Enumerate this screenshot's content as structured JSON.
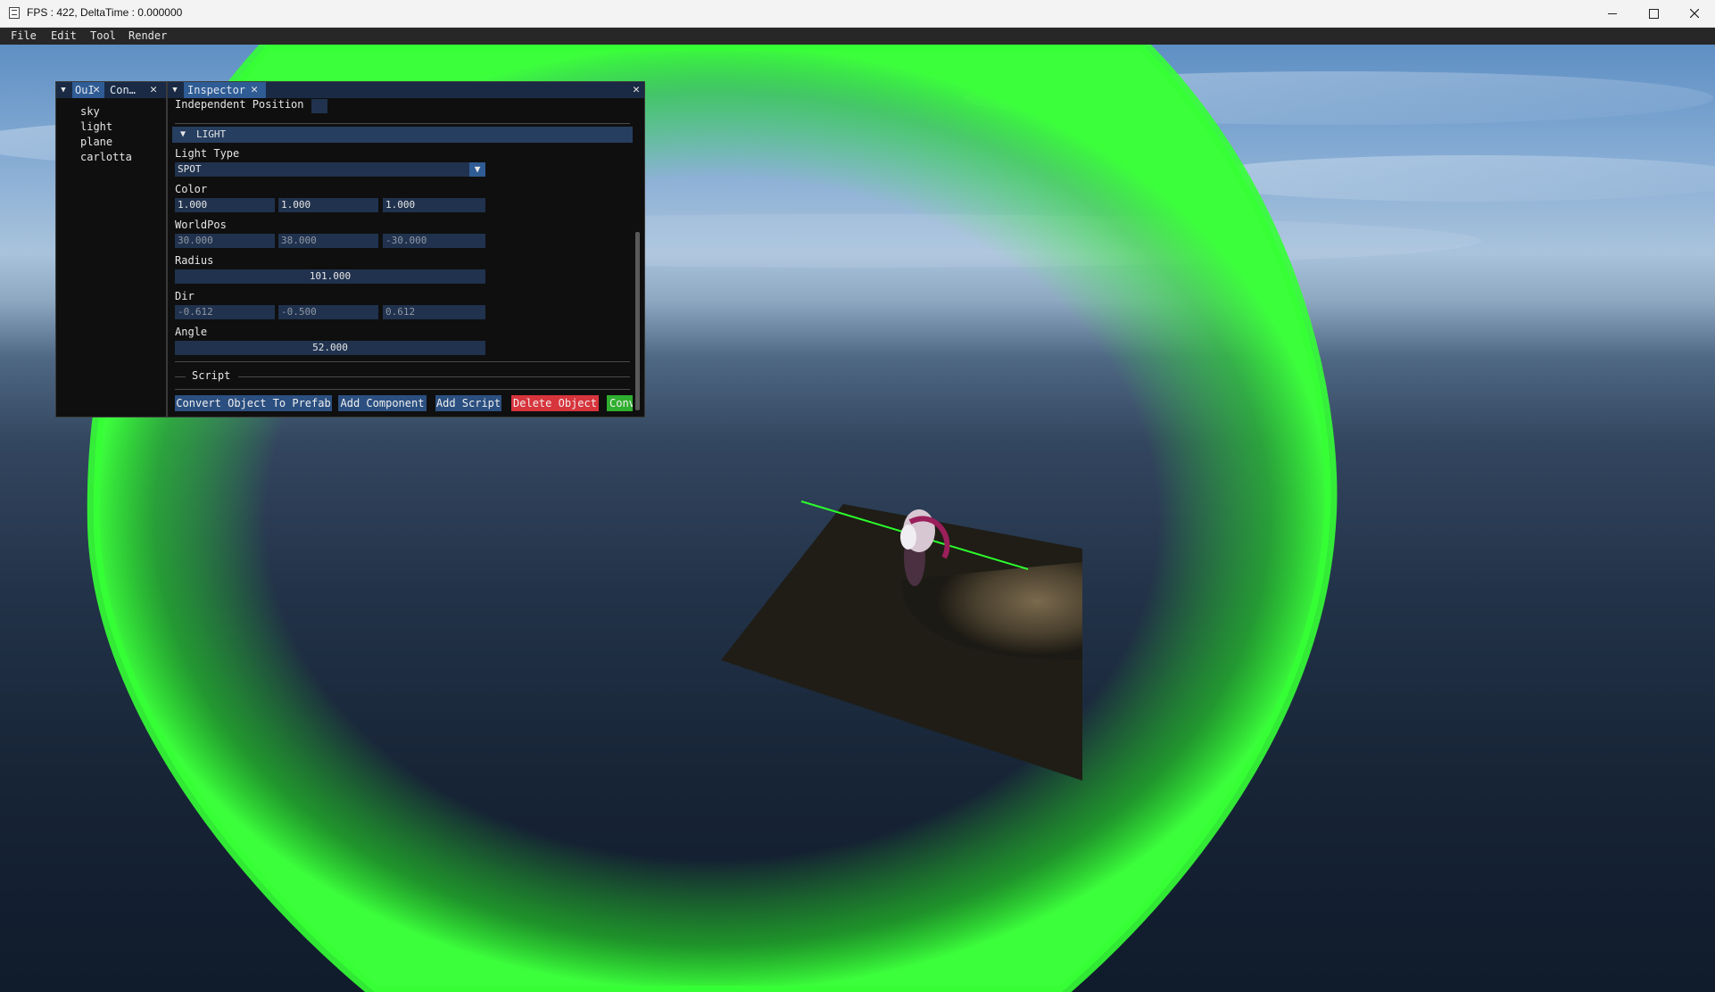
{
  "window": {
    "title": "FPS : 422, DeltaTime : 0.000000",
    "controls": [
      "minimize",
      "maximize",
      "close"
    ]
  },
  "menu": [
    "File",
    "Edit",
    "Tool",
    "Render"
  ],
  "outliner": {
    "tabs": [
      "OuI",
      "Con…"
    ],
    "items": [
      "sky",
      "light",
      "plane",
      "carlotta"
    ]
  },
  "inspector": {
    "tab": "Inspector",
    "independent_position_label": "Independent Position",
    "section_header": "LIGHT",
    "light_type_label": "Light Type",
    "light_type_value": "SPOT",
    "color_label": "Color",
    "color_values": [
      "1.000",
      "1.000",
      "1.000"
    ],
    "worldpos_label": "WorldPos",
    "worldpos_values": [
      "30.000",
      "38.000",
      "-30.000"
    ],
    "radius_label": "Radius",
    "radius_value": "101.000",
    "dir_label": "Dir",
    "dir_values": [
      "-0.612",
      "-0.500",
      "0.612"
    ],
    "angle_label": "Angle",
    "angle_value": "52.000",
    "script_label": "Script",
    "buttons": {
      "convert_prefab": "Convert Object To Prefab",
      "add_component": "Add Component",
      "add_script": "Add Script",
      "delete_object": "Delete Object",
      "convert_cut": "Conv"
    }
  },
  "colors": {
    "panel_bg": "#0f0f0f",
    "tab_active": "#2f5c94",
    "field_bg": "#20324e",
    "delete_button": "#d7343c",
    "convert_button": "#2faf2f",
    "light_volume": "#2cff2c"
  },
  "icons": [
    "app-icon",
    "chevron-down-icon",
    "close-icon",
    "dock-menu-icon",
    "collapse-arrow-icon"
  ]
}
